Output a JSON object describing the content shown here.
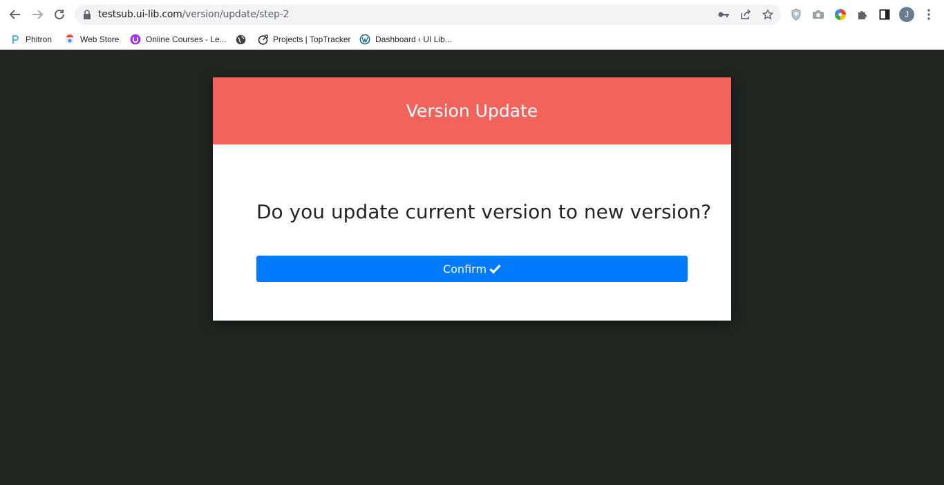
{
  "browser": {
    "url_host": "testsub.ui-lib.com",
    "url_path": "/version/update/step-2",
    "profile_initial": "J"
  },
  "bookmarks": [
    {
      "label": "Phitron",
      "icon": "phitron-icon"
    },
    {
      "label": "Web Store",
      "icon": "web-store-icon"
    },
    {
      "label": "Online Courses - Le...",
      "icon": "udemy-icon"
    },
    {
      "label": "",
      "icon": "globe-icon"
    },
    {
      "label": "Projects | TopTracker",
      "icon": "toptracker-icon"
    },
    {
      "label": "Dashboard ‹ UI Lib...",
      "icon": "wordpress-icon"
    }
  ],
  "card": {
    "title": "Version Update",
    "question": "Do you update current version to new version?",
    "confirm_label": "Confirm"
  },
  "colors": {
    "page_bg": "#212621",
    "header_bg": "#f2635c",
    "button_bg": "#007bff"
  }
}
